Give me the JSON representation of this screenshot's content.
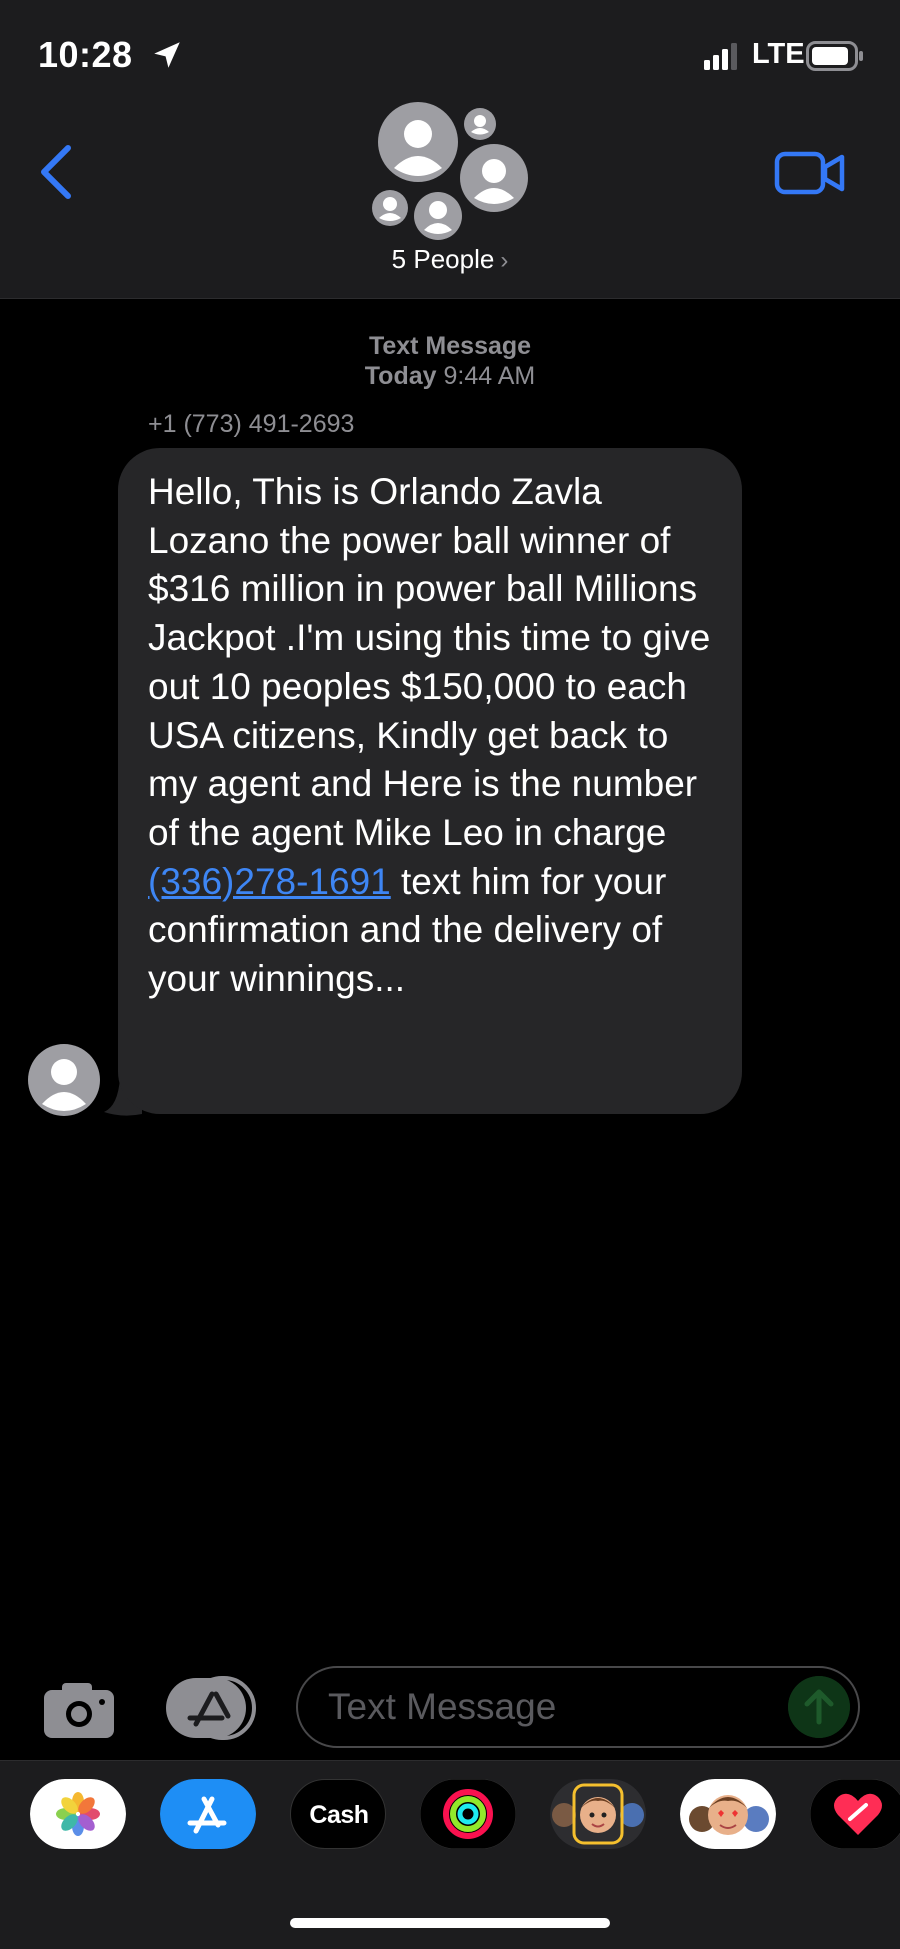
{
  "status_bar": {
    "time": "10:28",
    "network": "LTE"
  },
  "header": {
    "people_label": "5 People"
  },
  "thread": {
    "service_label": "Text Message",
    "timestamp_day": "Today",
    "timestamp_time": "9:44 AM",
    "sender_number": "+1 (773) 491-2693",
    "message_before_link": "Hello, This is Orlando Zavla Lozano the power ball winner of $316 million in power ball Millions Jackpot .I'm using this time to give out 10 peoples $150,000 to each USA citizens, Kindly get back to my agent and Here is the number of the agent Mike Leo in charge ",
    "message_link": "(336)278-1691",
    "message_after_link": " text him for your confirmation and the delivery of your winnings..."
  },
  "composer": {
    "placeholder": "Text Message"
  },
  "app_drawer": {
    "apps": [
      {
        "name": "photos-app-icon"
      },
      {
        "name": "app-store-icon"
      },
      {
        "name": "apple-cash-icon",
        "label": "Cash"
      },
      {
        "name": "activity-icon"
      },
      {
        "name": "memoji-icon"
      },
      {
        "name": "memoji-stickers-icon"
      },
      {
        "name": "digital-touch-icon"
      }
    ]
  },
  "colors": {
    "accent_blue": "#3478f6",
    "link_blue": "#3e86f4",
    "bubble_gray": "#262628",
    "header_bg": "#1c1c1e",
    "meta_gray": "#8e8e93"
  }
}
